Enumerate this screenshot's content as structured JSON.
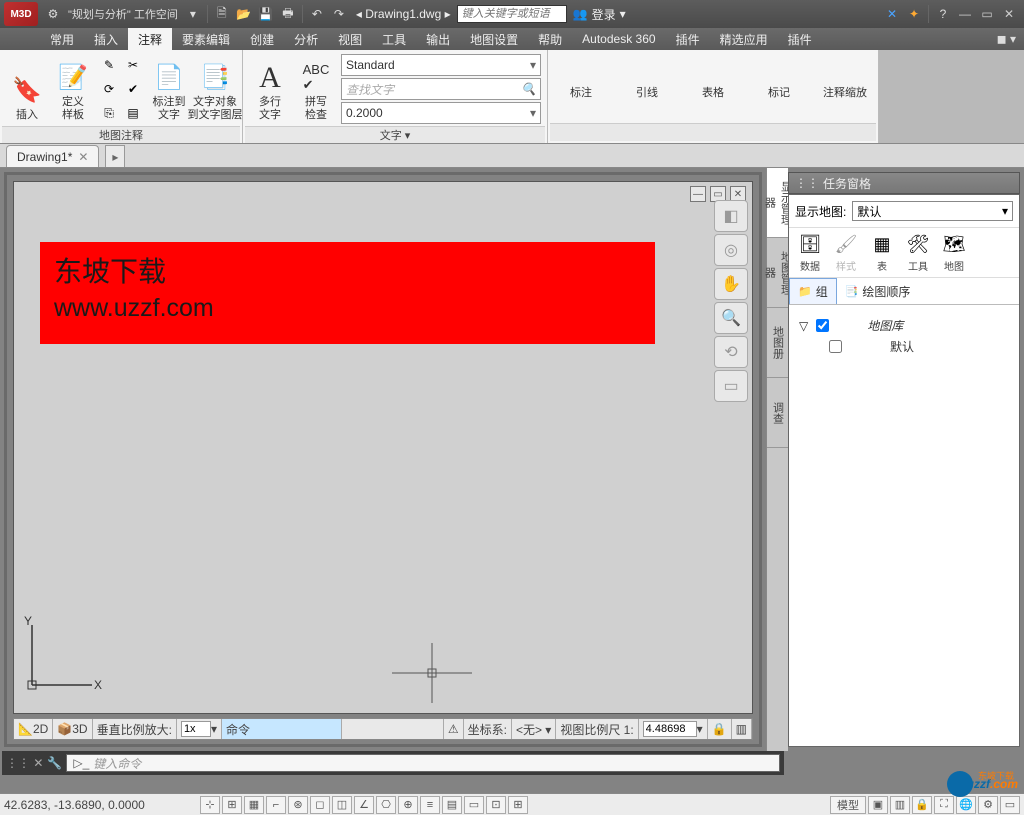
{
  "titlebar": {
    "app_logo": "M3D",
    "workspace": "\"规划与分析\" 工作空间",
    "filename": "Drawing1.dwg",
    "search_placeholder": "键入关键字或短语",
    "login": "登录"
  },
  "menu": {
    "items": [
      "常用",
      "插入",
      "注释",
      "要素编辑",
      "创建",
      "分析",
      "视图",
      "工具",
      "输出",
      "地图设置",
      "帮助",
      "Autodesk 360",
      "插件",
      "精选应用",
      "插件"
    ],
    "active_index": 2
  },
  "ribbon": {
    "panel1": {
      "title": "地图注释",
      "btn_insert": "插入",
      "btn_template": "定义\n样板",
      "btn_annotate": "标注到\n文字",
      "btn_text_layer": "文字对象\n到文字图层"
    },
    "panel2": {
      "title": "文字 ▾",
      "btn_mtext": "多行\n文字",
      "btn_spell": "拼写\n检查",
      "style": "Standard",
      "find_placeholder": "查找文字",
      "height": "0.2000"
    },
    "panel3": {
      "btn_dim": "标注",
      "btn_lead": "引线",
      "btn_table": "表格",
      "btn_mark": "标记",
      "btn_annoscale": "注释缩放"
    }
  },
  "filetab": {
    "name": "Drawing1*"
  },
  "canvas": {
    "banner_line1": "东坡下载",
    "banner_line2": "www.uzzf.com",
    "ucs_y": "Y",
    "ucs_x": "X"
  },
  "viewport_status": {
    "mode2d": "2D",
    "mode3d": "3D",
    "vexag_label": "垂直比例放大:",
    "vexag_val": "1x",
    "cmd_label": "命令",
    "coord_label": "坐标系:",
    "coord_val": "<无> ▾",
    "scale_label": "视图比例尺 1:",
    "scale_val": "4.48698"
  },
  "taskpane": {
    "title": "任务窗格",
    "show_map_label": "显示地图:",
    "show_map_value": "默认",
    "tools": [
      {
        "lb": "数据"
      },
      {
        "lb": "样式"
      },
      {
        "lb": "表"
      },
      {
        "lb": "工具"
      },
      {
        "lb": "地图"
      }
    ],
    "tab_group": "组",
    "tab_order": "绘图顺序",
    "tree_root": "地图库",
    "tree_child": "默认",
    "side_tabs": [
      "显示管理器",
      "地图管理器",
      "地图册",
      "调查"
    ]
  },
  "cmdline": {
    "placeholder": "键入命令"
  },
  "statusbar": {
    "coords": "42.6283, -13.6890, 0.0000",
    "model": "模型"
  },
  "watermark": {
    "text": "uzzf",
    "suffix": ".com",
    "tag": "东坡下载"
  }
}
